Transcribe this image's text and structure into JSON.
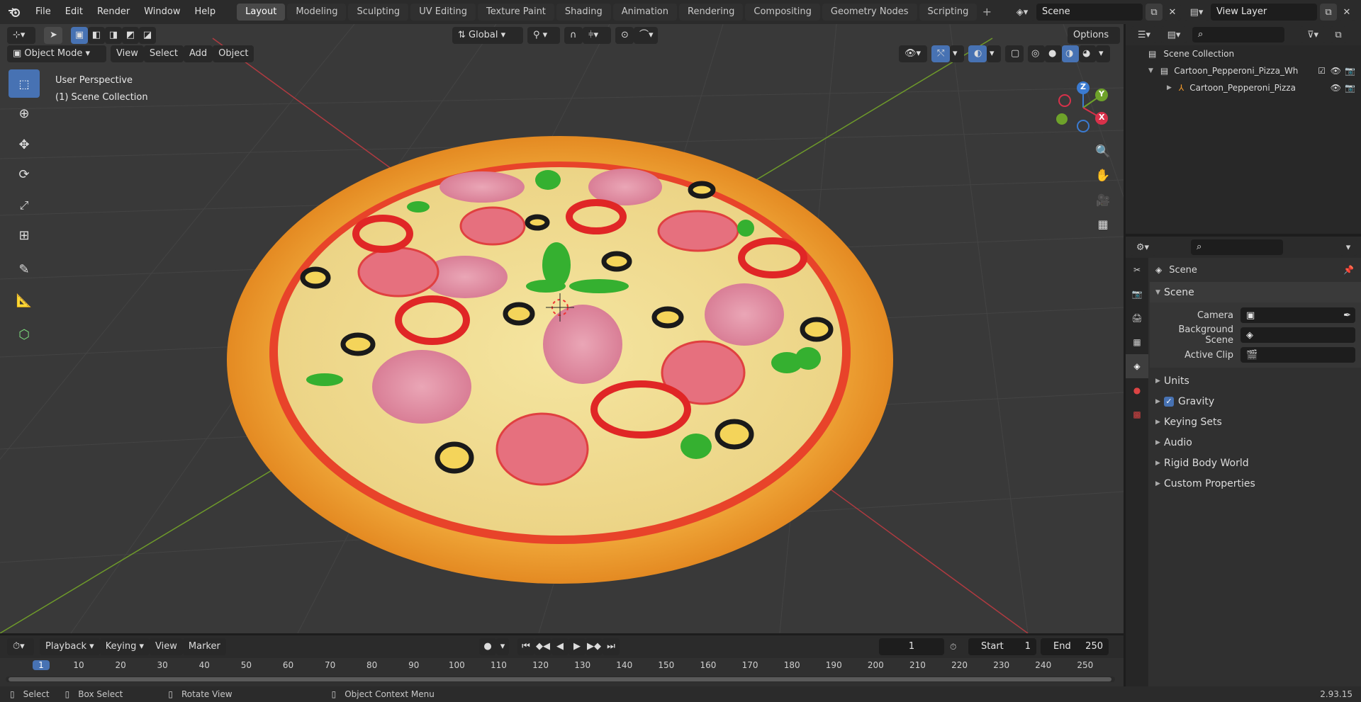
{
  "menu": [
    "File",
    "Edit",
    "Render",
    "Window",
    "Help"
  ],
  "workspaces": [
    "Layout",
    "Modeling",
    "Sculpting",
    "UV Editing",
    "Texture Paint",
    "Shading",
    "Animation",
    "Rendering",
    "Compositing",
    "Geometry Nodes",
    "Scripting"
  ],
  "active_workspace": "Layout",
  "scene_field": "Scene",
  "view_layer_field": "View Layer",
  "viewport": {
    "mode": "Object Mode",
    "header_menus": [
      "View",
      "Select",
      "Add",
      "Object"
    ],
    "transform_orientation": "Global",
    "options_label": "Options",
    "overlay_title": "User Perspective",
    "overlay_collection": "(1) Scene Collection",
    "gizmo_axes": {
      "z": "Z",
      "y": "Y",
      "x": "X"
    }
  },
  "outliner": {
    "root": "Scene Collection",
    "items": [
      {
        "label": "Cartoon_Pepperoni_Pizza_Wh"
      },
      {
        "label": "Cartoon_Pepperoni_Pizza"
      }
    ]
  },
  "properties": {
    "context_label": "Scene",
    "panel_title": "Scene",
    "fields": [
      {
        "label": "Camera"
      },
      {
        "label": "Background Scene"
      },
      {
        "label": "Active Clip"
      }
    ],
    "panels": [
      "Units",
      "Gravity",
      "Keying Sets",
      "Audio",
      "Rigid Body World",
      "Custom Properties"
    ]
  },
  "timeline": {
    "menus": [
      "Playback",
      "Keying",
      "View",
      "Marker"
    ],
    "current_frame": "1",
    "start_label": "Start",
    "start_value": "1",
    "end_label": "End",
    "end_value": "250",
    "ruler": [
      "1",
      "10",
      "20",
      "30",
      "40",
      "50",
      "60",
      "70",
      "80",
      "90",
      "100",
      "110",
      "120",
      "130",
      "140",
      "150",
      "160",
      "170",
      "180",
      "190",
      "200",
      "210",
      "220",
      "230",
      "240",
      "250"
    ]
  },
  "statusbar": {
    "select": "Select",
    "box_select": "Box Select",
    "rotate_view": "Rotate View",
    "context_menu": "Object Context Menu",
    "version": "2.93.15"
  }
}
